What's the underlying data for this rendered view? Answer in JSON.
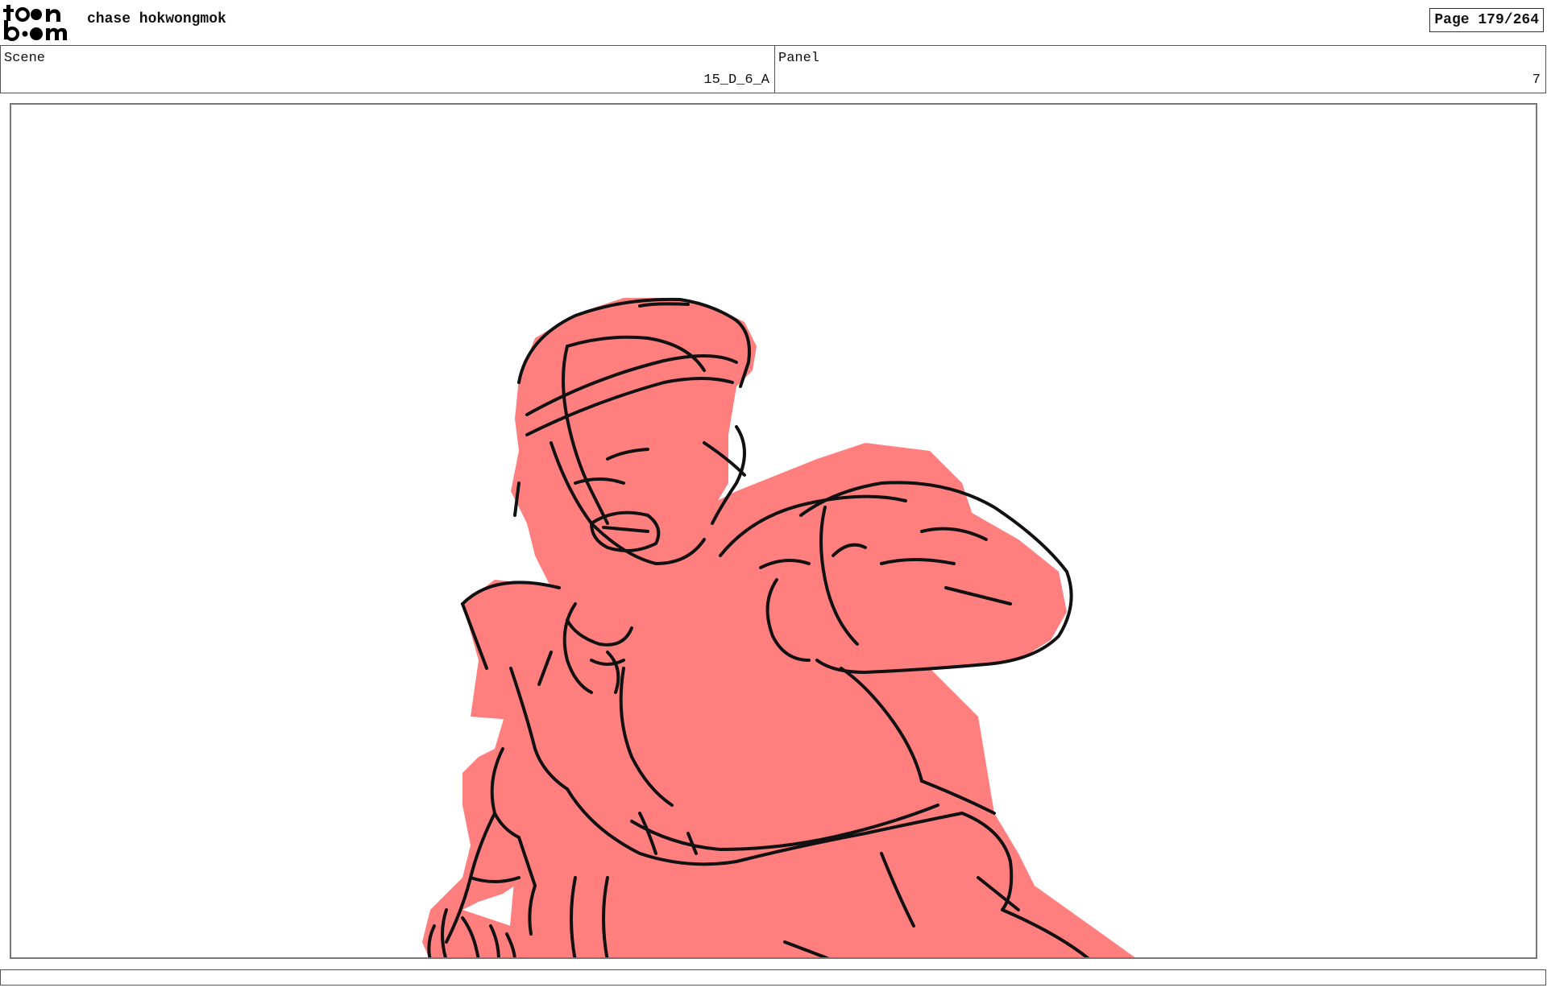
{
  "header": {
    "logo_top": "toon",
    "logo_bottom": "boom",
    "author": "chase hokwongmok",
    "page": "Page 179/264"
  },
  "scene": {
    "label": "Scene",
    "value": "15_D_6_A"
  },
  "panel": {
    "label": "Panel",
    "value": "7"
  },
  "drawing": {
    "fill_color": "#ff7f7f",
    "line_color": "#111111",
    "subject": "sketch-character-punching"
  }
}
